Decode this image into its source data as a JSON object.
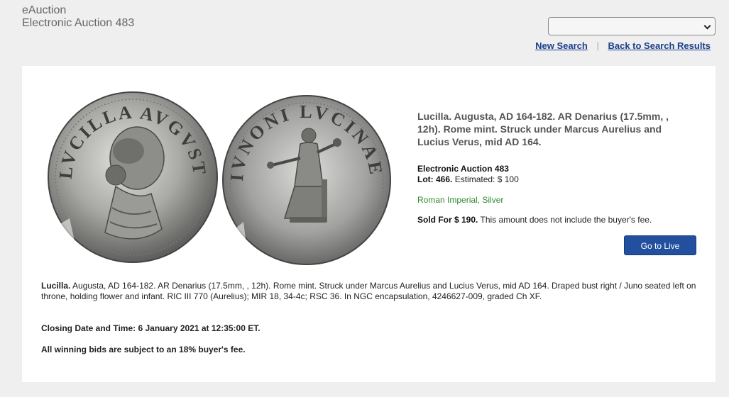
{
  "header": {
    "site_name": "eAuction",
    "auction_name": "Electronic Auction 483",
    "select_value": "",
    "new_search": "New Search",
    "separator": "|",
    "back_to_results": "Back to Search Results"
  },
  "lot": {
    "title": "Lucilla. Augusta, AD 164-182. AR Denarius (17.5mm, , 12h). Rome mint. Struck under Marcus Aurelius and Lucius Verus, mid AD 164.",
    "auction": "Electronic Auction 483",
    "lot_label": "Lot: 466.",
    "estimate": "Estimated: $ 100",
    "category": "Roman Imperial, Silver",
    "sold_label": "Sold For $ 190.",
    "sold_note": "This amount does not include the buyer's fee.",
    "go_live_label": "Go to Live",
    "desc_lead": "Lucilla.",
    "desc_body": "Augusta, AD 164-182. AR Denarius (17.5mm, , 12h). Rome mint. Struck under Marcus Aurelius and Lucius Verus, mid AD 164. Draped bust right / Juno seated left on throne, holding flower and infant. RIC III 770 (Aurelius); MIR 18, 34-4c; RSC 36. In NGC encapsulation, 4246627-009, graded Ch XF.",
    "closing": "Closing Date and Time: 6 January 2021 at 12:35:00 ET.",
    "buyers_fee": "All winning bids are subject to an 18% buyer's fee."
  },
  "coins": {
    "obverse_legend": "LVCILLA AVGVSTA",
    "reverse_legend": "IVNONI LVCINAE"
  },
  "colors": {
    "link": "#1b3f8c",
    "button": "#23509e",
    "category": "#2f8a2f"
  }
}
